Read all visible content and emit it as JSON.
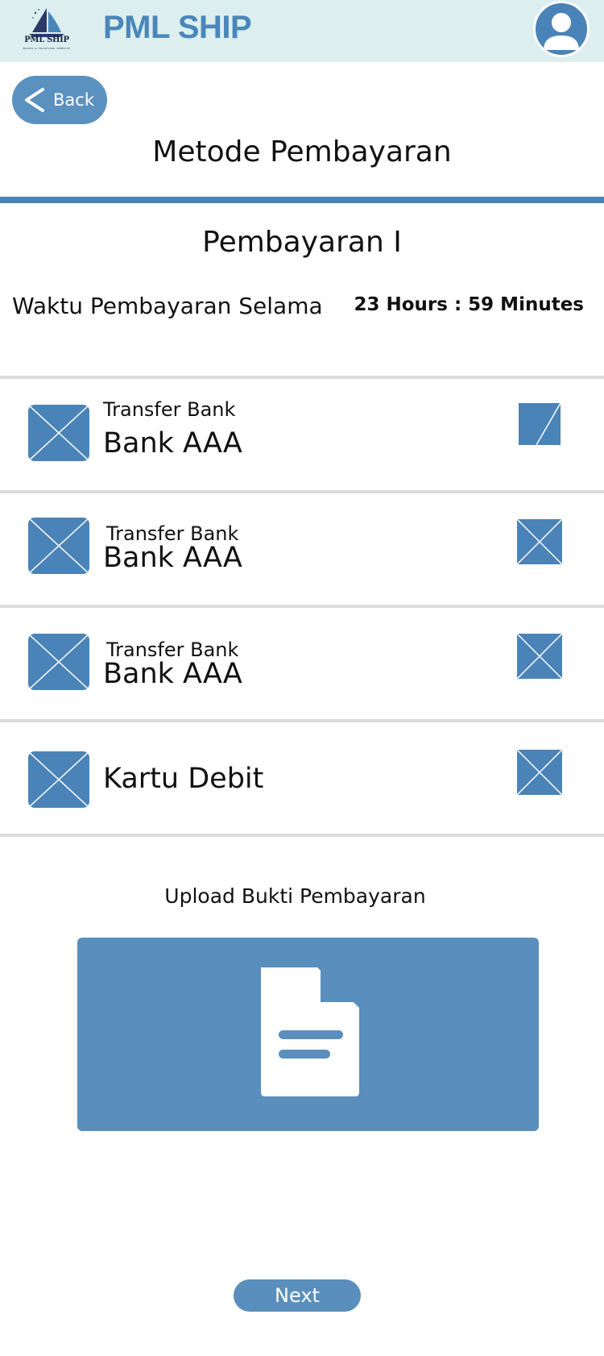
{
  "header": {
    "logo_text": "PML SHIP",
    "logo_subtext": "BOOKS & TRAVELING WEBSITE",
    "brand": "PML SHIP"
  },
  "nav": {
    "back_label": "Back"
  },
  "page": {
    "title": "Metode Pembayaran",
    "section_title": "Pembayaran I",
    "time_label": "Waktu Pembayaran Selama",
    "time_value": "23 Hours : 59 Minutes"
  },
  "methods": [
    {
      "sub": "Transfer Bank",
      "name": "Bank AAA",
      "selected": true
    },
    {
      "sub": "Transfer Bank",
      "name": "Bank AAA",
      "selected": false
    },
    {
      "sub": "Transfer Bank",
      "name": "Bank AAA",
      "selected": false
    },
    {
      "sub": "",
      "name": "Kartu Debit",
      "selected": false
    }
  ],
  "upload": {
    "label": "Upload Bukti Pembayaran"
  },
  "footer": {
    "next_label": "Next"
  },
  "colors": {
    "accent": "#4a83b7",
    "header_bg": "#dcefee",
    "button_bg": "#5a8fbd",
    "divider": "#dcdcdc"
  }
}
